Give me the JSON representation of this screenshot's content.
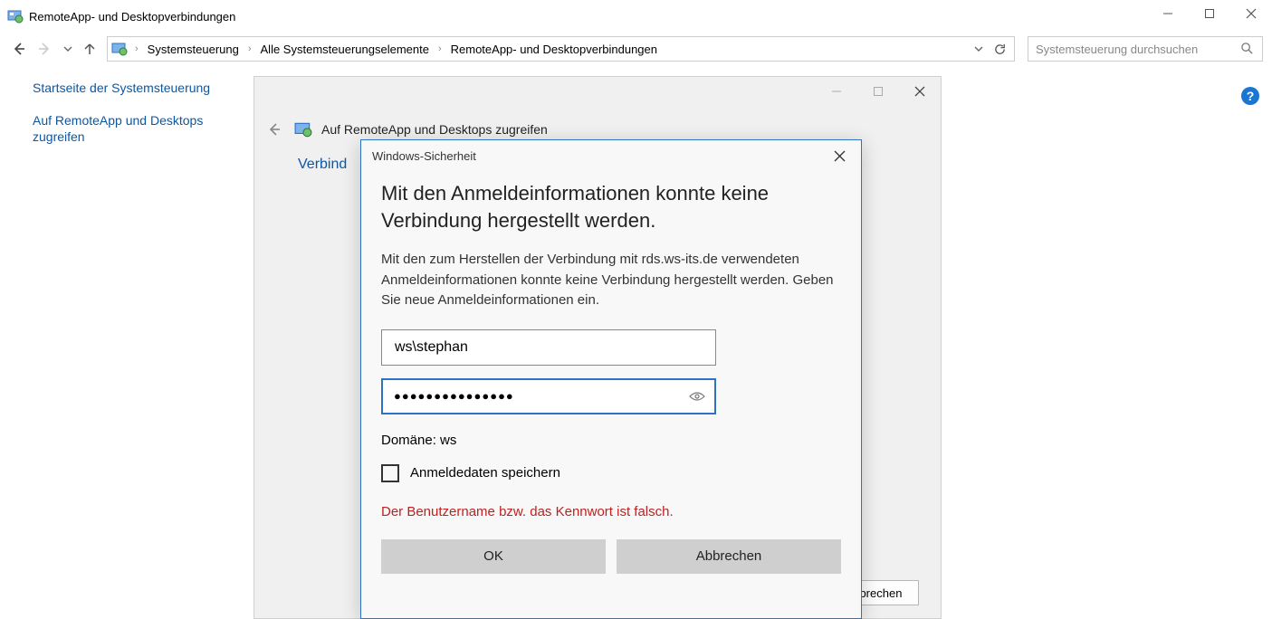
{
  "window": {
    "title": "RemoteApp- und Desktopverbindungen",
    "controls": {
      "min": "—",
      "max": "□",
      "close": "✕"
    }
  },
  "nav": {
    "breadcrumbs": [
      "Systemsteuerung",
      "Alle Systemsteuerungselemente",
      "RemoteApp- und Desktopverbindungen"
    ],
    "search_placeholder": "Systemsteuerung durchsuchen"
  },
  "sidebar": {
    "home": "Startseite der Systemsteuerung",
    "access": "Auf RemoteApp und Desktops zugreifen"
  },
  "wizard": {
    "title": "Auf RemoteApp und Desktops zugreifen",
    "body_heading_truncated": "Verbind",
    "cancel": "Abbrechen"
  },
  "security": {
    "title": "Windows-Sicherheit",
    "heading": "Mit den Anmeldeinformationen konnte keine Verbindung hergestellt werden.",
    "message": "Mit den zum Herstellen der Verbindung mit rds.ws-its.de verwendeten Anmeldeinformationen konnte keine Verbindung hergestellt werden. Geben Sie neue Anmeldeinformationen ein.",
    "username": "ws\\stephan",
    "password_masked": "●●●●●●●●●●●●●●●",
    "domain_label": "Domäne: ws",
    "remember": "Anmeldedaten speichern",
    "error": "Der Benutzername bzw. das Kennwort ist falsch.",
    "ok": "OK",
    "cancel": "Abbrechen"
  },
  "help_badge": "?"
}
